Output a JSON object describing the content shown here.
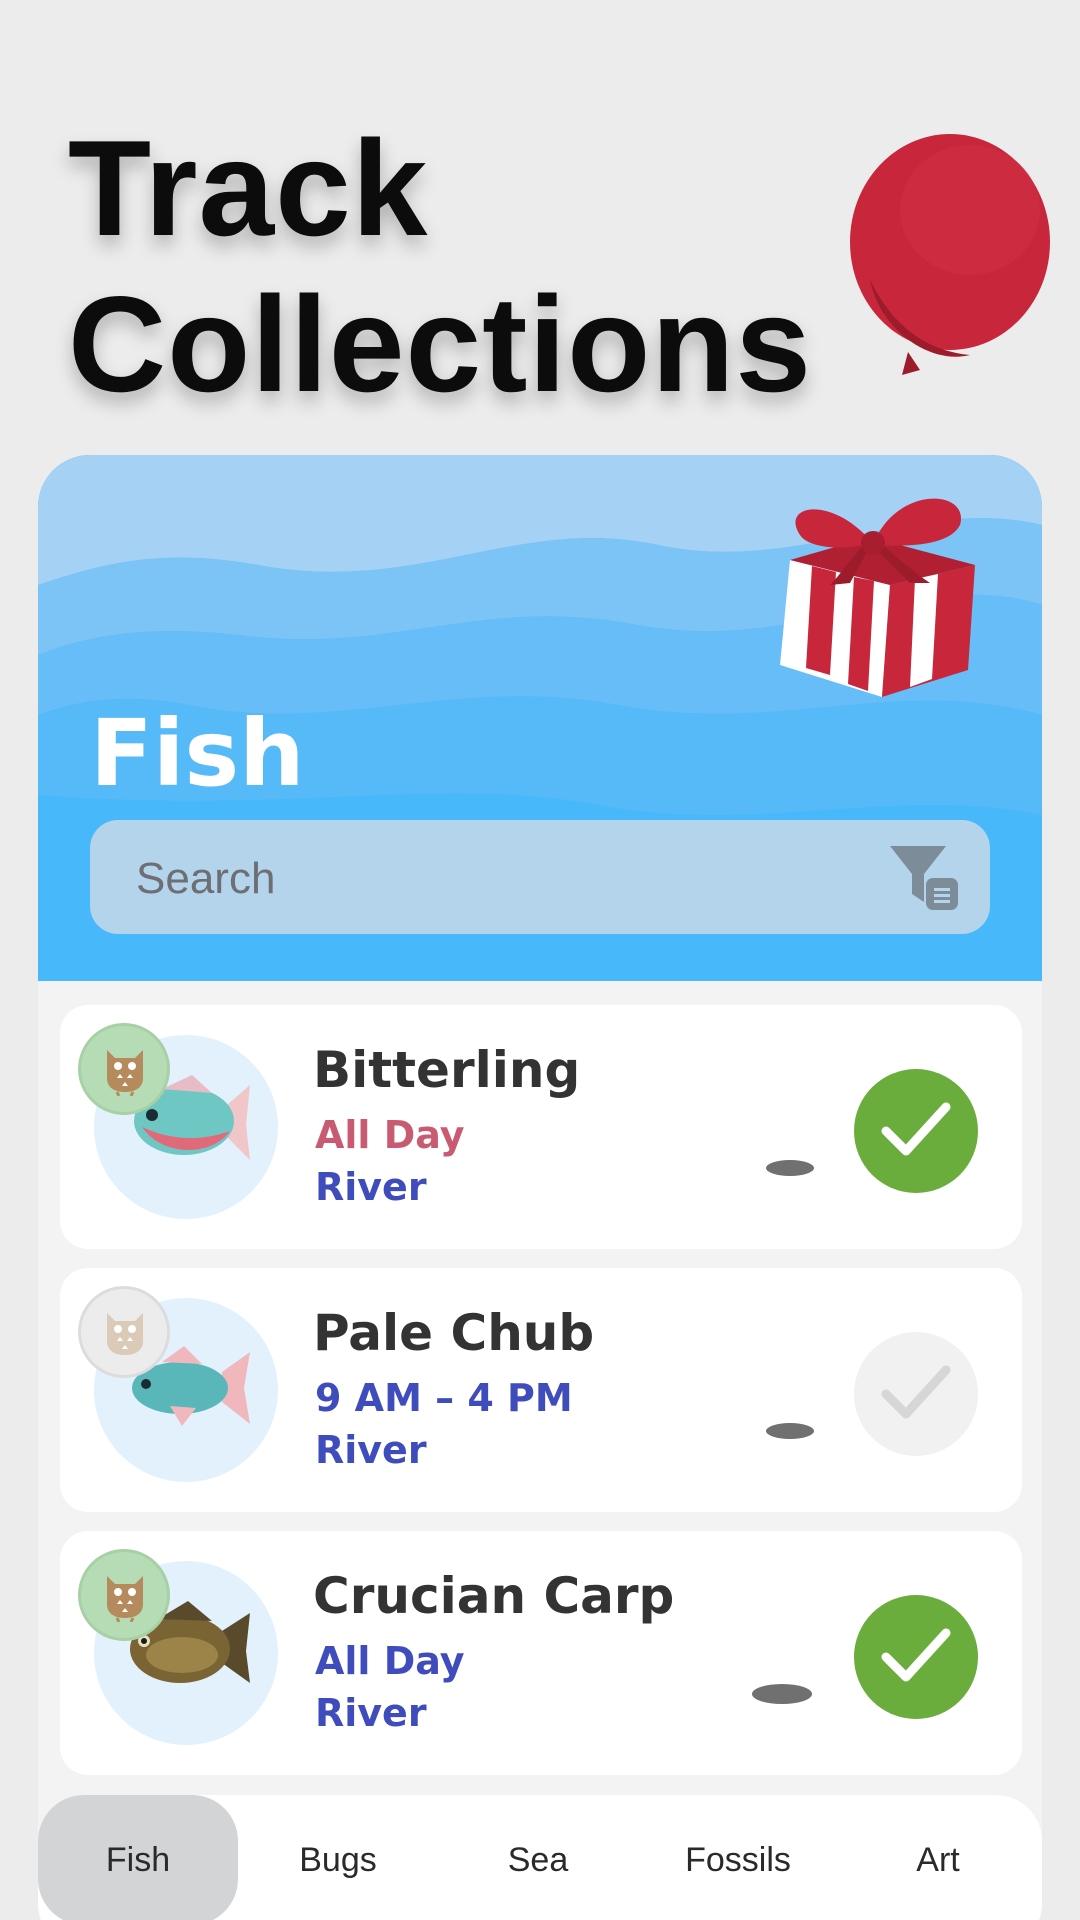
{
  "headline": {
    "line1": "Track",
    "line2": "Collections"
  },
  "header": {
    "title": "Fish",
    "search_placeholder": "Search"
  },
  "colors": {
    "header_blue": "#47b8f9",
    "caught_green": "#6aad3d",
    "time_pink": "#c85a72",
    "time_blue": "#3f4cbc",
    "location_blue": "#3f4cbc"
  },
  "fish": [
    {
      "name": "Bitterling",
      "time": "All Day",
      "time_color": "#c85a72",
      "location": "River",
      "caught": true,
      "donated": true
    },
    {
      "name": "Pale Chub",
      "time": "9 AM – 4 PM",
      "time_color": "#3f4cbc",
      "location": "River",
      "caught": false,
      "donated": false
    },
    {
      "name": "Crucian Carp",
      "time": "All Day",
      "time_color": "#3f4cbc",
      "location": "River",
      "caught": true,
      "donated": true
    }
  ],
  "tabs": [
    {
      "label": "Fish",
      "active": true
    },
    {
      "label": "Bugs",
      "active": false
    },
    {
      "label": "Sea",
      "active": false
    },
    {
      "label": "Fossils",
      "active": false
    },
    {
      "label": "Art",
      "active": false
    }
  ],
  "icons": {
    "balloon": "balloon-icon",
    "gift": "gift-icon",
    "filter": "filter-icon",
    "owl": "owl-icon",
    "check": "check-icon",
    "shadow": "fish-shadow-icon"
  }
}
